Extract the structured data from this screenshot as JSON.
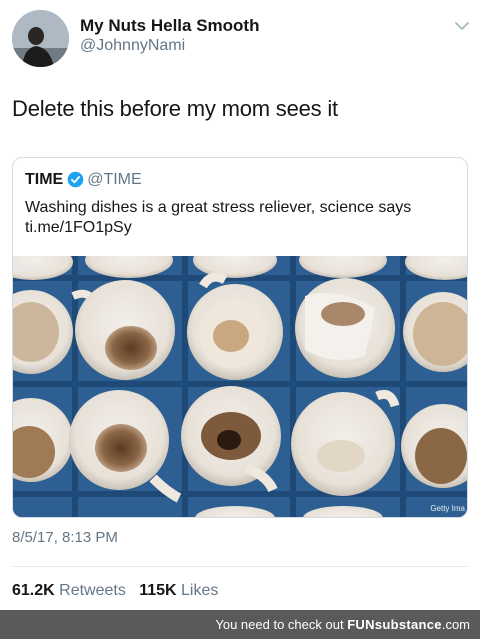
{
  "tweet": {
    "display_name": "My Nuts Hella Smooth",
    "handle": "@JohnnyNami",
    "text": "Delete this before my mom sees it",
    "timestamp": "8/5/17, 8:13 PM",
    "retweets_count": "61.2K",
    "retweets_label": "Retweets",
    "likes_count": "115K",
    "likes_label": "Likes"
  },
  "quoted_tweet": {
    "name": "TIME",
    "handle": "@TIME",
    "text": "Washing dishes is a great stress reliever, science says ti.me/1FO1pSy",
    "photo_watermark_left": "ME",
    "photo_watermark_right": "Getty Ima"
  },
  "footer": {
    "caption": "You need to check out",
    "brand_fun": "FUN",
    "brand_substance": "substance",
    "brand_tld": ".com"
  },
  "colors": {
    "verified_blue": "#1da1f2",
    "secondary_text": "#657786",
    "crate_blue": "#2d5f92",
    "footer_bar": "#5a5a5a"
  },
  "icons": {
    "verified": "verified-badge-icon",
    "menu": "chevron-down-icon"
  }
}
